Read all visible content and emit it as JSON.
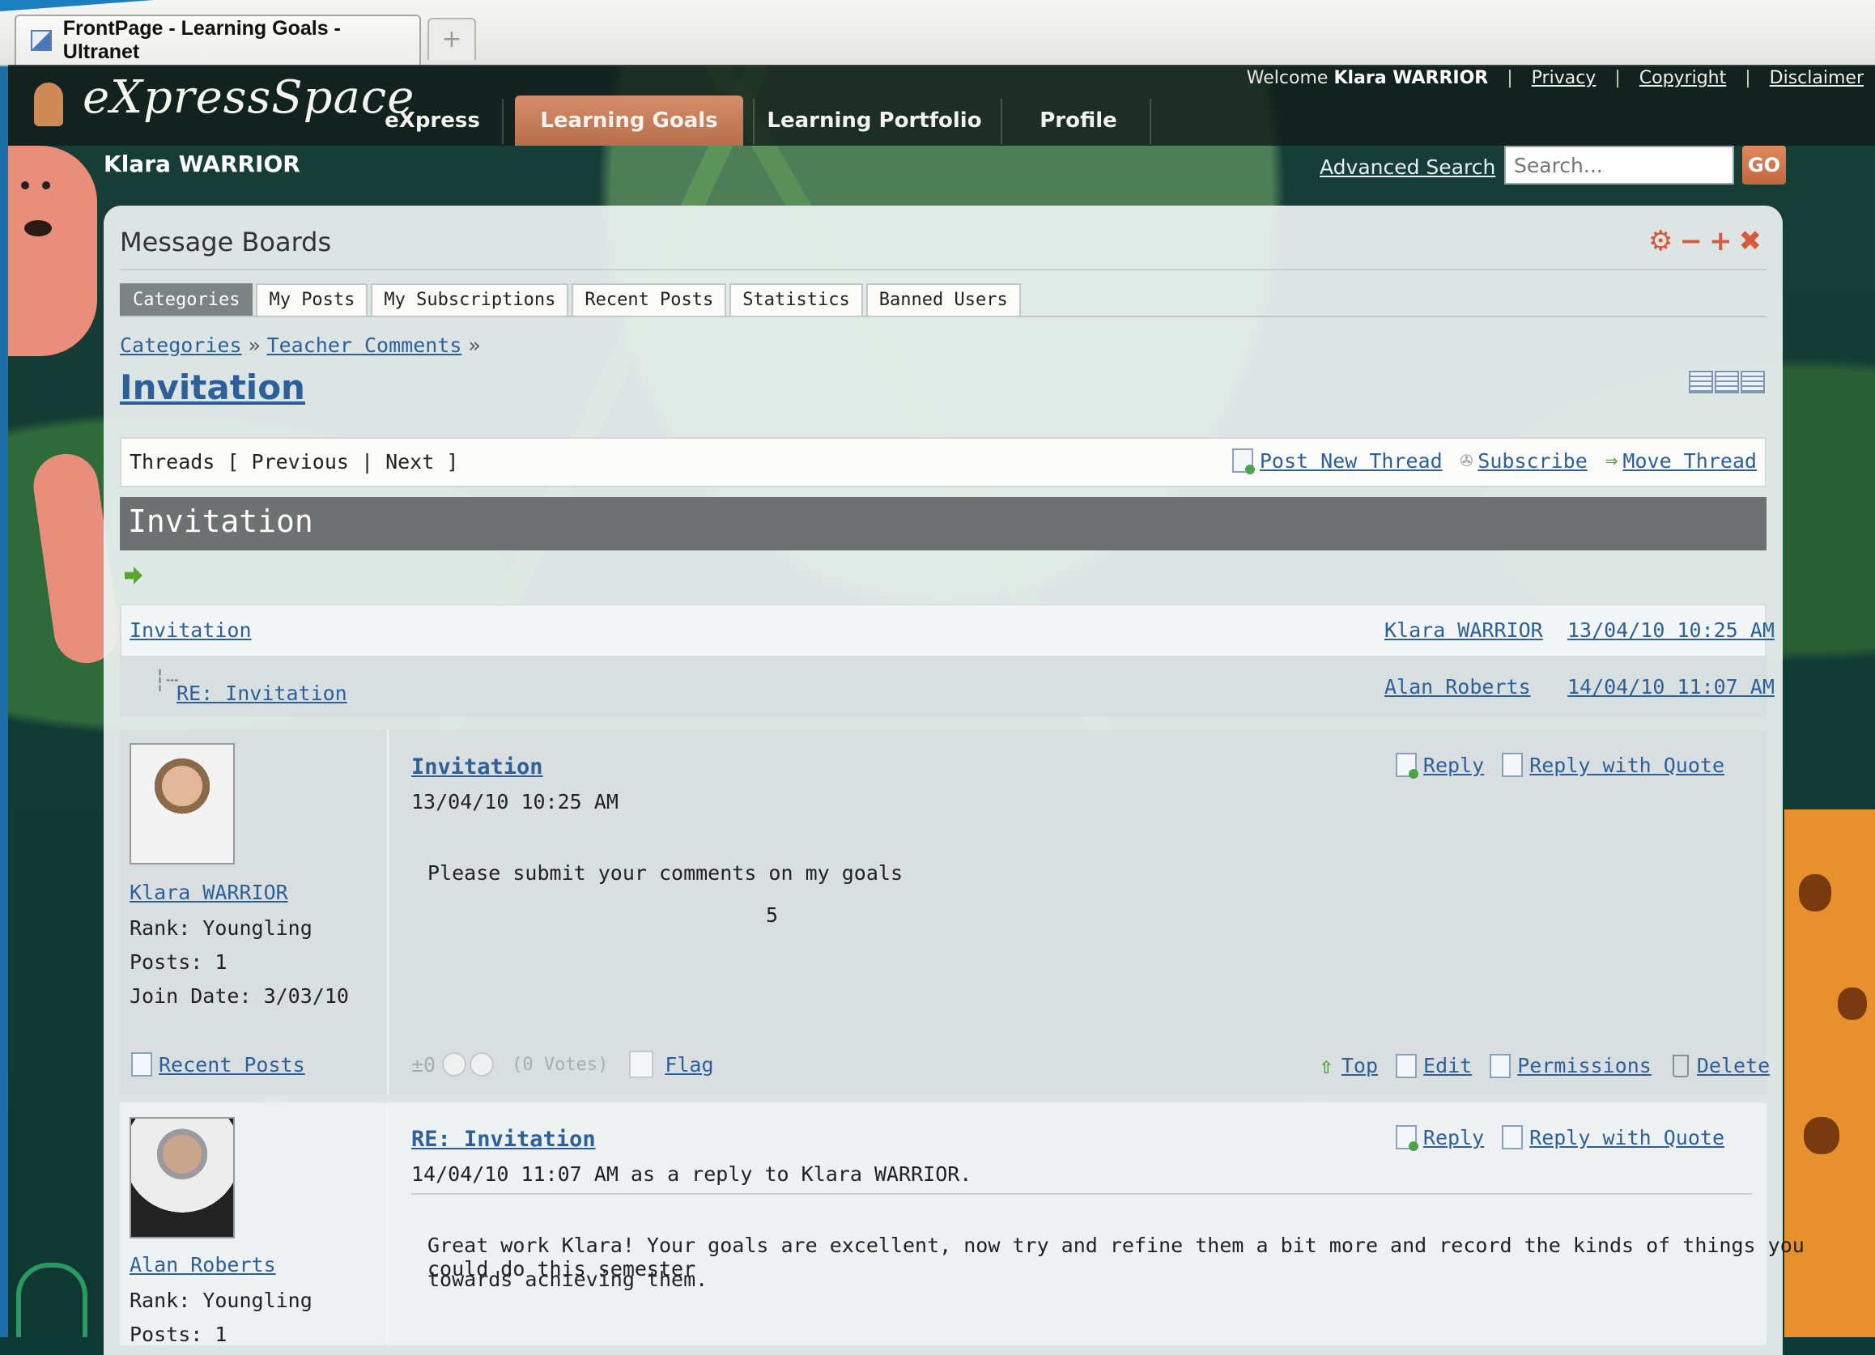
{
  "browser": {
    "tab_title": "FrontPage - Learning Goals - Ultranet",
    "new_tab_symbol": "+"
  },
  "site": {
    "logo_text": "eXpressSpace",
    "nav": [
      {
        "label": "eXpress"
      },
      {
        "label": "Learning Goals",
        "active": true
      },
      {
        "label": "Learning Portfolio"
      },
      {
        "label": "Profile"
      }
    ],
    "welcome_prefix": "Welcome",
    "welcome_user": "Klara WARRIOR",
    "top_links": [
      "Privacy",
      "Copyright",
      "Disclaimer"
    ],
    "user_name": "Klara WARRIOR",
    "advanced_search": "Advanced Search",
    "search_placeholder": "Search...",
    "search_button": "GO"
  },
  "portlet": {
    "title": "Message Boards",
    "tabs": [
      "Categories",
      "My Posts",
      "My Subscriptions",
      "Recent Posts",
      "Statistics",
      "Banned Users"
    ],
    "active_tab": "Categories",
    "breadcrumb": [
      "Categories",
      "Teacher Comments"
    ],
    "breadcrumb_sep": "»",
    "page_title": "Invitation",
    "threads_nav": "Threads [ Previous | Next ]",
    "actions": [
      "Post New Thread",
      "Subscribe",
      "Move Thread"
    ],
    "thread_title": "Invitation",
    "tree": [
      {
        "title": "Invitation",
        "author": "Klara WARRIOR",
        "date": "13/04/10 10:25 AM"
      },
      {
        "title": "RE: Invitation",
        "author": "Alan Roberts",
        "date": "14/04/10 11:07 AM"
      }
    ]
  },
  "posts": [
    {
      "author": "Klara WARRIOR",
      "rank": "Rank: Youngling",
      "posts": "Posts: 1",
      "join_date": "Join Date: 3/03/10",
      "recent_posts": "Recent Posts",
      "title": "Invitation",
      "meta": "13/04/10 10:25 AM",
      "body": "Please submit your comments on my goals",
      "body_extra": "5",
      "reply": "Reply",
      "reply_quote": "Reply with Quote",
      "vote_score": "±0",
      "votes": "(0 Votes)",
      "flag": "Flag",
      "footer_actions": [
        "Top",
        "Edit",
        "Permissions",
        "Delete"
      ]
    },
    {
      "author": "Alan Roberts",
      "rank": "Rank: Youngling",
      "posts": "Posts: 1",
      "title": "RE: Invitation",
      "meta": "14/04/10 11:07 AM as a reply to Klara WARRIOR.",
      "body_line1": "Great work Klara! Your goals are excellent, now try and refine them a bit more and record the kinds of things you could do this semester",
      "body_line2": "towards achieving them.",
      "reply": "Reply",
      "reply_quote": "Reply with Quote"
    }
  ]
}
